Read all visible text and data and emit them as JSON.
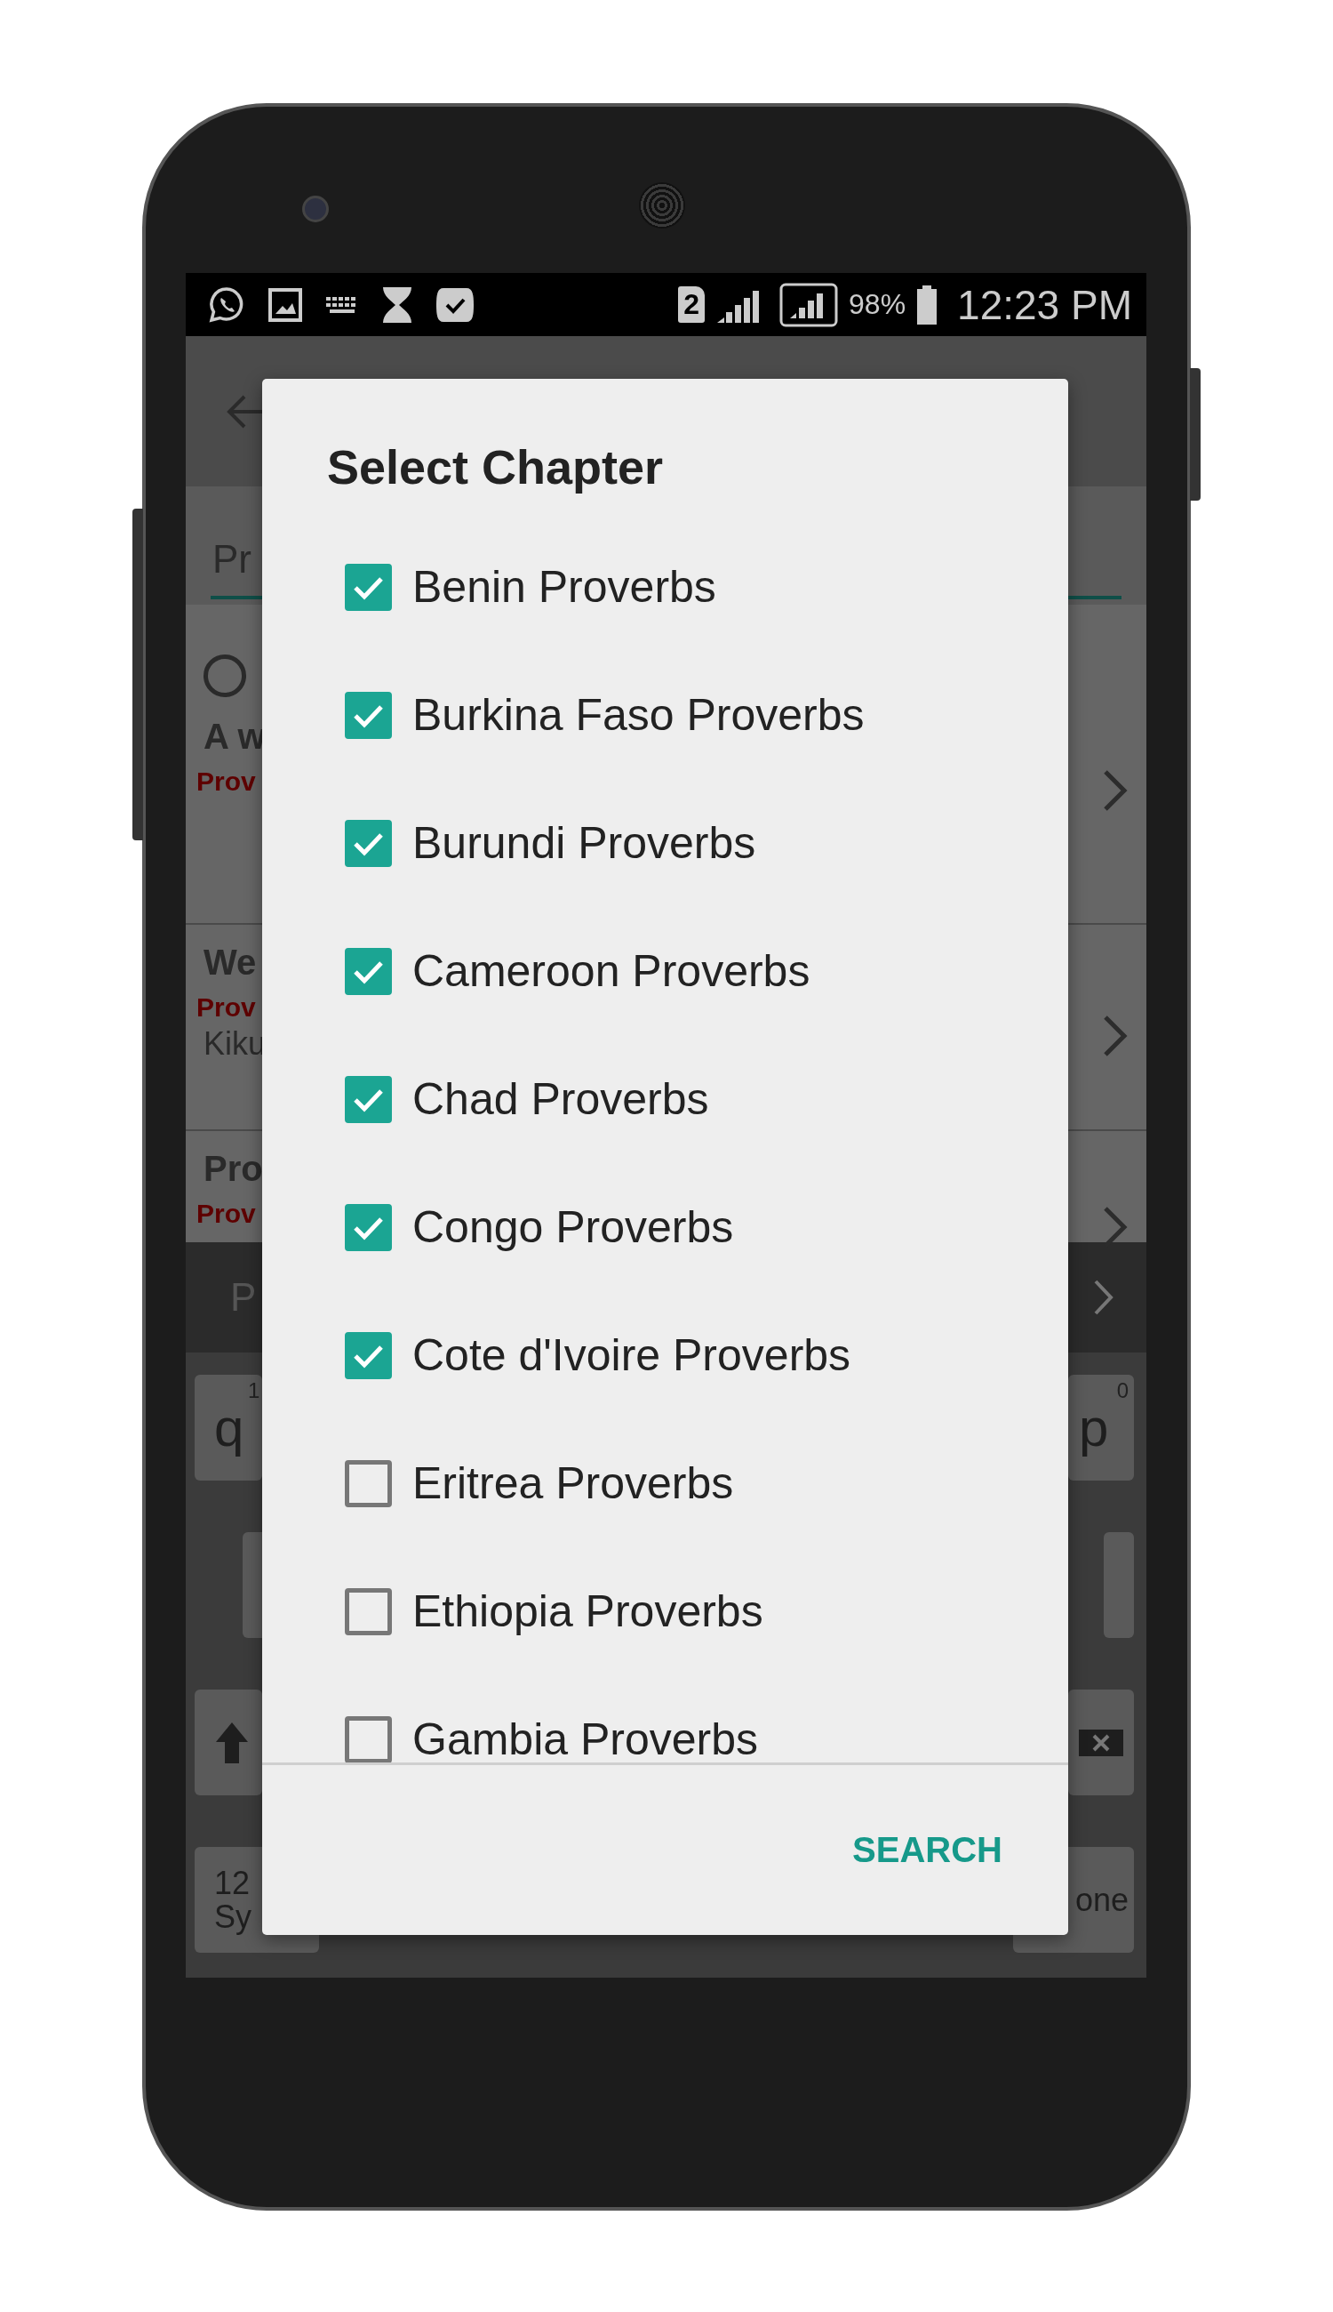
{
  "status_bar": {
    "sim": "2",
    "battery": "98%",
    "time": "12:23 PM"
  },
  "background_app": {
    "tab": "Pr",
    "list": [
      {
        "title": "A w",
        "subtitle": "Prov",
        "radio": {
          "selected": false
        }
      },
      {
        "title": "We",
        "subtitle": "Prov",
        "detail": "Kiku"
      },
      {
        "title": "Pro",
        "subtitle": "Prov"
      }
    ],
    "suggestion": "P",
    "keyboard": {
      "q_key": {
        "label": "q",
        "hint": "1"
      },
      "p_key": {
        "label": "p",
        "hint": "0"
      },
      "symbols_key": [
        "12",
        "Sy"
      ],
      "done_key": "one"
    }
  },
  "dialog": {
    "title": "Select Chapter",
    "items": [
      {
        "label": "Benin Proverbs",
        "checked": true
      },
      {
        "label": "Burkina Faso Proverbs",
        "checked": true
      },
      {
        "label": "Burundi Proverbs",
        "checked": true
      },
      {
        "label": "Cameroon Proverbs",
        "checked": true
      },
      {
        "label": "Chad Proverbs",
        "checked": true
      },
      {
        "label": "Congo Proverbs",
        "checked": true
      },
      {
        "label": "Cote d'Ivoire Proverbs",
        "checked": true
      },
      {
        "label": "Eritrea Proverbs",
        "checked": false
      },
      {
        "label": "Ethiopia Proverbs",
        "checked": false
      },
      {
        "label": "Gambia Proverbs",
        "checked": false
      }
    ],
    "button": "SEARCH"
  }
}
